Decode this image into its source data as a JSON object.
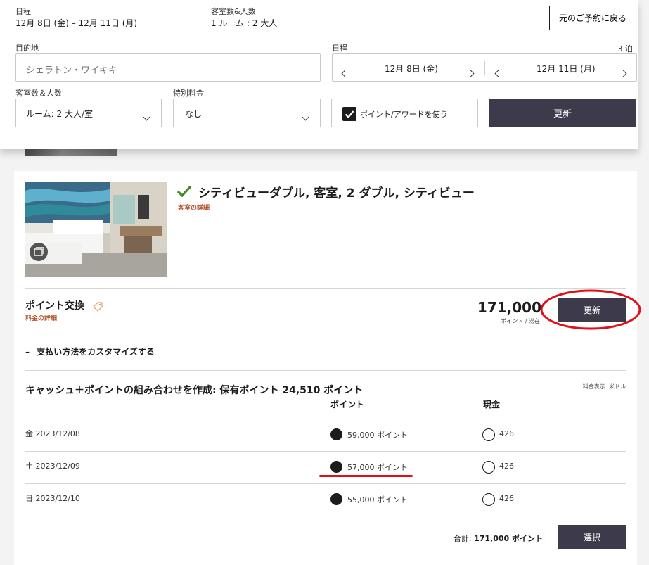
{
  "summary": {
    "dates_label": "日程",
    "dates_value": "12月 8日 (金) – 12月 11日 (月)",
    "rooms_label": "客室数&人数",
    "rooms_value": "1 ルーム : 2 大人",
    "back_button": "元のご予約に戻る"
  },
  "search": {
    "destination_label": "目的地",
    "destination_value": "シェラトン・ワイキキ",
    "dates_label": "日程",
    "nights": "3 泊",
    "checkin": "12月 8日 (金)",
    "checkout": "12月 11日 (月)",
    "rooms_label": "客室数＆人数",
    "rooms_value": "ルーム: 2 大人/室",
    "special_rate_label": "特別料金",
    "special_rate_value": "なし",
    "use_points_label": "ポイント/アワードを使う",
    "use_points_checked": true,
    "update_button": "更新"
  },
  "room": {
    "title": "シティビューダブル, 客室, 2 ダブル, シティビュー",
    "details_link": "客室の詳細",
    "check_color": "#3f8a1b"
  },
  "rate": {
    "name": "ポイント交換",
    "details_link": "料金の詳細",
    "points": "171,000",
    "per_stay": "ポイント / 滞在",
    "update_button": "更新"
  },
  "customize": {
    "toggle_label": "支払い方法をカスタマイズする",
    "toggle_symbol": "–"
  },
  "combo": {
    "title": "キャッシュ＋ポイントの組み合わせを作成: 保有ポイント 24,510 ポイント",
    "currency_note": "料金表示: 米ドル",
    "col_points": "ポイント",
    "col_cash": "現金",
    "rows": [
      {
        "date": "金 2023/12/08",
        "points": "59,000 ポイント",
        "cash": "426"
      },
      {
        "date": "土 2023/12/09",
        "points": "57,000 ポイント",
        "cash": "426"
      },
      {
        "date": "日 2023/12/10",
        "points": "55,000 ポイント",
        "cash": "426"
      }
    ],
    "total_label": "合計:",
    "total_value": "171,000 ポイント",
    "select_button": "選択"
  },
  "colors": {
    "primary_button": "#3d3a4b",
    "link_accent": "#b5522e",
    "annotation_red": "#e0101a"
  }
}
